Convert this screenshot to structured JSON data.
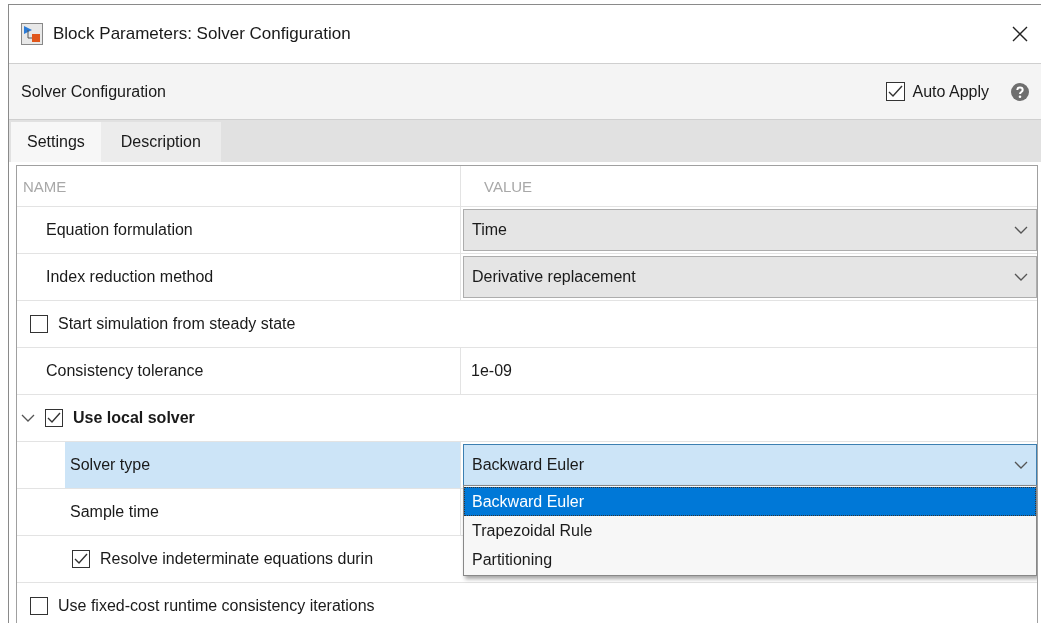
{
  "window": {
    "title": "Block Parameters: Solver Configuration"
  },
  "toolbar": {
    "title": "Solver Configuration",
    "auto_apply": {
      "label": "Auto Apply",
      "checked": true
    }
  },
  "tabs": [
    {
      "label": "Settings",
      "selected": true
    },
    {
      "label": "Description",
      "selected": false
    }
  ],
  "table": {
    "columns": [
      "NAME",
      "VALUE"
    ],
    "rows": [
      {
        "kind": "dropdown",
        "name": "Equation formulation",
        "value": "Time",
        "selected": false
      },
      {
        "kind": "dropdown",
        "name": "Index reduction method",
        "value": "Derivative replacement",
        "selected": false
      },
      {
        "kind": "checkbox",
        "name": "Start simulation from steady state",
        "checked": false
      },
      {
        "kind": "text",
        "name": "Consistency tolerance",
        "value": "1e-09"
      },
      {
        "kind": "group",
        "name": "Use local solver",
        "checked": true,
        "expanded": true,
        "children": [
          {
            "kind": "dropdown",
            "name": "Solver type",
            "value": "Backward Euler",
            "selected": true,
            "options": [
              {
                "label": "Backward Euler",
                "selected": true
              },
              {
                "label": "Trapezoidal Rule",
                "selected": false
              },
              {
                "label": "Partitioning",
                "selected": false
              }
            ]
          },
          {
            "kind": "text",
            "name": "Sample time"
          },
          {
            "kind": "checkbox",
            "name": "Resolve indeterminate equations durin",
            "checked": true
          }
        ]
      },
      {
        "kind": "checkbox",
        "name": "Use fixed-cost runtime consistency iterations",
        "checked": false
      }
    ]
  }
}
